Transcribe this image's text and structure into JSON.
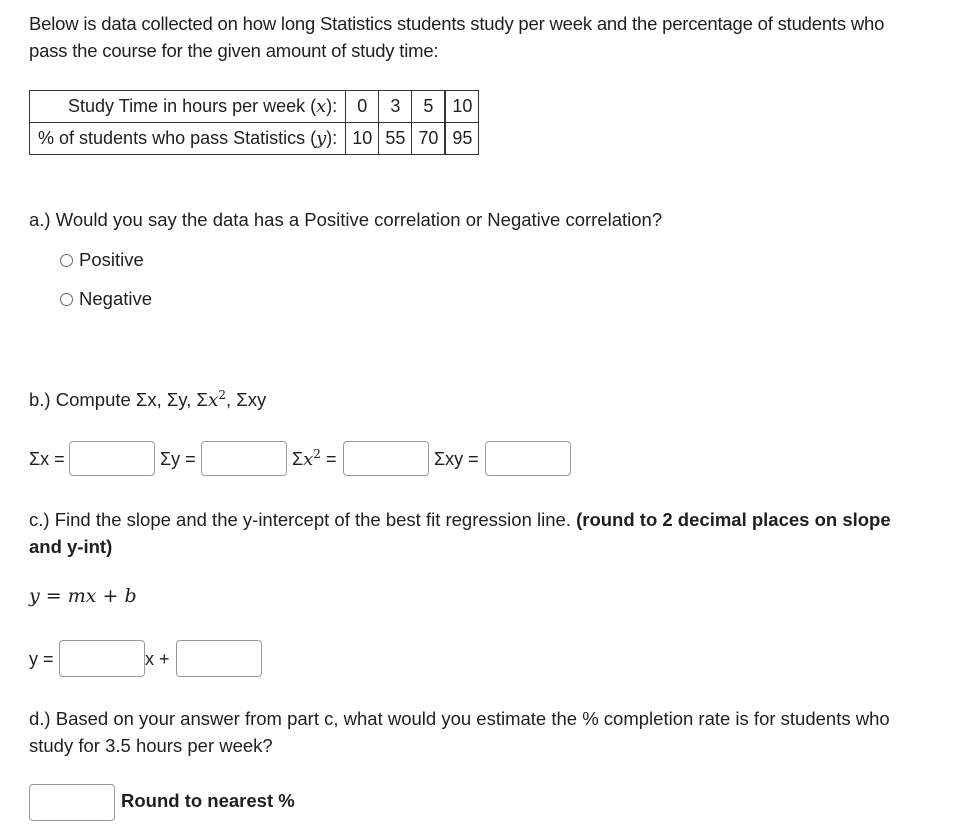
{
  "intro": "Below is data collected on how long Statistics students study per week and the percentage of students who pass the course for the given amount of study time:",
  "table": {
    "row_x": {
      "label_prefix": "Study Time in hours per week (",
      "var": "x",
      "label_suffix": "):",
      "values": [
        "0",
        "3",
        "5",
        "10"
      ]
    },
    "row_y": {
      "label_prefix": "% of students who pass Statistics (",
      "var": "y",
      "label_suffix": "):",
      "values": [
        "10",
        "55",
        "70",
        "95"
      ]
    }
  },
  "part_a": {
    "question": "a.) Would you say the data has a Positive correlation or Negative correlation?",
    "options": [
      "Positive",
      "Negative"
    ]
  },
  "part_b": {
    "question_prefix": "b.) Compute Σx, Σy, Σ",
    "question_x2": "x",
    "question_sup": "2",
    "question_suffix": ", Σxy",
    "labels": {
      "sum_x": "Σx =",
      "sum_y": "Σy =",
      "sum_x2_sigma": "Σ",
      "sum_x2_var": "x",
      "sum_x2_sup": "2",
      "sum_x2_eq": " =",
      "sum_xy": "Σxy ="
    },
    "values": {
      "sum_x": "",
      "sum_y": "",
      "sum_x2": "",
      "sum_xy": ""
    }
  },
  "part_c": {
    "question_plain": "c.) Find the slope and the y-intercept of the best fit regression line. ",
    "question_bold": "(round to 2 decimal places on slope and y-int)",
    "formula": "y = mx + b",
    "y_label": "y =",
    "x_plus_label": "x +",
    "values": {
      "slope": "",
      "intercept": ""
    }
  },
  "part_d": {
    "question": "d.) Based on your answer from part c, what would you estimate the % completion rate is for students who study for 3.5 hours per week?",
    "hint": "Round to nearest %",
    "value": ""
  }
}
